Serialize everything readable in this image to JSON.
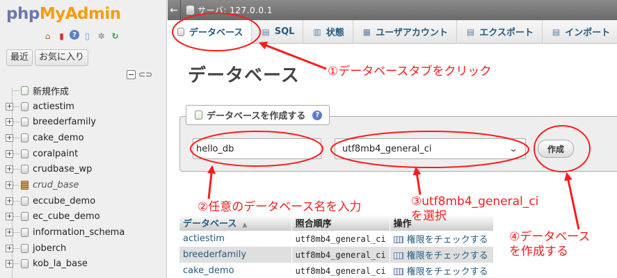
{
  "app": {
    "logo_php": "php",
    "logo_admin": "MyAdmin"
  },
  "sidebar": {
    "tabs": [
      "最近",
      "お気に入り"
    ],
    "icons": [
      "home-icon",
      "exit-icon",
      "help-icon",
      "docs-icon",
      "gear-icon",
      "reload-icon"
    ],
    "new_label": "新規作成",
    "databases": [
      {
        "name": "actiestim",
        "style": "normal"
      },
      {
        "name": "breederfamily",
        "style": "normal"
      },
      {
        "name": "cake_demo",
        "style": "normal"
      },
      {
        "name": "coralpaint",
        "style": "normal"
      },
      {
        "name": "crudbase_wp",
        "style": "normal"
      },
      {
        "name": "crud_base",
        "style": "italic"
      },
      {
        "name": "eccube_demo",
        "style": "normal"
      },
      {
        "name": "ec_cube_demo",
        "style": "normal"
      },
      {
        "name": "information_schema",
        "style": "normal"
      },
      {
        "name": "joberch",
        "style": "normal"
      },
      {
        "name": "kob_la_base",
        "style": "normal"
      }
    ]
  },
  "topbar": {
    "back_glyph": "←",
    "server_label": "サーバ: 127.0.0.1"
  },
  "tabs": [
    {
      "label": "データベース",
      "icon": "database-icon",
      "active": true
    },
    {
      "label": "SQL",
      "icon": "sql-icon",
      "active": false
    },
    {
      "label": "状態",
      "icon": "status-icon",
      "active": false
    },
    {
      "label": "ユーザアカウント",
      "icon": "users-icon",
      "active": false
    },
    {
      "label": "エクスポート",
      "icon": "export-icon",
      "active": false
    },
    {
      "label": "インポート",
      "icon": "import-icon",
      "active": false
    }
  ],
  "main": {
    "title": "データベース",
    "create_section": {
      "legend": "データベースを作成する",
      "db_name_value": "hello_db",
      "collation_value": "utf8mb4_general_ci",
      "create_label": "作成"
    },
    "table": {
      "headers": {
        "database": "データベース",
        "collation": "照合順序",
        "action": "操作"
      },
      "rows": [
        {
          "name": "actiestim",
          "collation": "utf8mb4_general_ci",
          "action": "権限をチェックする"
        },
        {
          "name": "breederfamily",
          "collation": "utf8mb4_general_ci",
          "action": "権限をチェックする"
        },
        {
          "name": "cake_demo",
          "collation": "utf8mb4_general_ci",
          "action": "権限をチェックする"
        }
      ]
    }
  },
  "annotations": {
    "step1": "①データベースタブをクリック",
    "step2": "②任意のデータベース名を入力",
    "step3_line1": "③utf8mb4_general_ci",
    "step3_line2": "を選択",
    "step4_line1": "④データベース",
    "step4_line2": "を作成する",
    "color": "#ff1a1a"
  }
}
